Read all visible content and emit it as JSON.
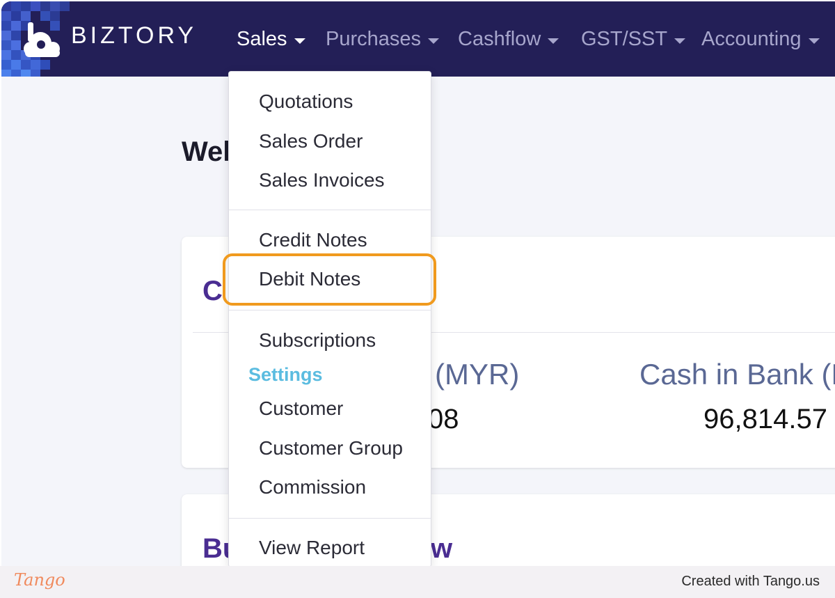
{
  "brand": {
    "name": "BIZTORY"
  },
  "nav": {
    "items": [
      {
        "label": "Sales",
        "active": true
      },
      {
        "label": "Purchases"
      },
      {
        "label": "Cashflow"
      },
      {
        "label": "GST/SST"
      },
      {
        "label": "Accounting"
      }
    ]
  },
  "page": {
    "welcome_partial": "Wel",
    "card1": {
      "title_partial": "C",
      "stat1_label_partial": "(MYR)",
      "stat1_value_partial": "08",
      "stat2_label_partial": "Cash in Bank (M",
      "stat2_value": "96,814.57"
    },
    "card2": {
      "title_partial_start": "Bu",
      "title_partial_end": "w"
    }
  },
  "dropdown": {
    "items": [
      {
        "label": "Quotations"
      },
      {
        "label": "Sales Order"
      },
      {
        "label": "Sales Invoices"
      },
      {
        "label": "Credit Notes"
      },
      {
        "label": "Debit Notes",
        "highlighted": true
      },
      {
        "label": "Subscriptions"
      },
      {
        "label": "Customer"
      },
      {
        "label": "Customer Group"
      },
      {
        "label": "Commission"
      },
      {
        "label": "View Report"
      }
    ],
    "settings_header": "Settings"
  },
  "footer": {
    "logo_text": "Tango",
    "credit": "Created with Tango.us"
  },
  "colors": {
    "navbar": "#231f57",
    "highlight": "#f09a1e",
    "settings_header": "#5bbce0",
    "card_title": "#4a2d92"
  }
}
